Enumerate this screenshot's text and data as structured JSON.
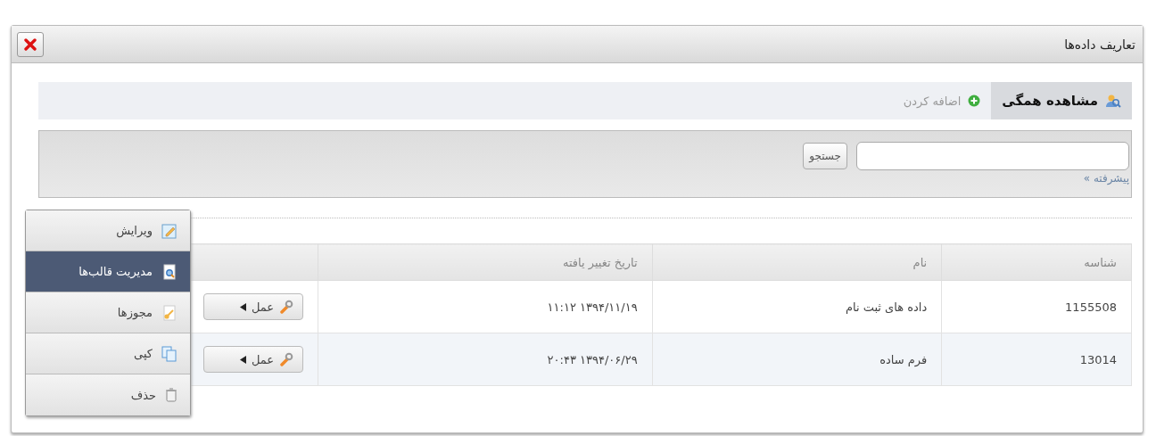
{
  "window": {
    "title": "تعاریف داده‌ها"
  },
  "tabs": [
    {
      "label": "مشاهده همگی",
      "selected": true,
      "kind": "view"
    },
    {
      "label": "اضافه کردن",
      "selected": false,
      "kind": "add"
    }
  ],
  "search": {
    "button": "جستجو",
    "advanced_link": "پیشرفته »"
  },
  "table": {
    "columns": [
      "شناسه",
      "نام",
      "تاریخ تغییر یافته"
    ],
    "rows": [
      {
        "id": "1155508",
        "name": "داده های ثبت نام",
        "modified": "۱۳۹۴/۱۱/۱۹ ۱۱:۱۲",
        "action": "عمل"
      },
      {
        "id": "13014",
        "name": "فرم ساده",
        "modified": "۱۳۹۴/۰۶/۲۹ ۲۰:۴۳",
        "action": "عمل"
      }
    ]
  },
  "context_menu": {
    "items": [
      {
        "label": "ویرایش",
        "kind": "edit",
        "selected": false
      },
      {
        "label": "مدیریت قالب‌ها",
        "kind": "templates",
        "selected": true
      },
      {
        "label": "مجوزها",
        "kind": "permissions",
        "selected": false
      },
      {
        "label": "کپی",
        "kind": "copy",
        "selected": false
      },
      {
        "label": "حذف",
        "kind": "delete",
        "selected": false
      }
    ]
  }
}
